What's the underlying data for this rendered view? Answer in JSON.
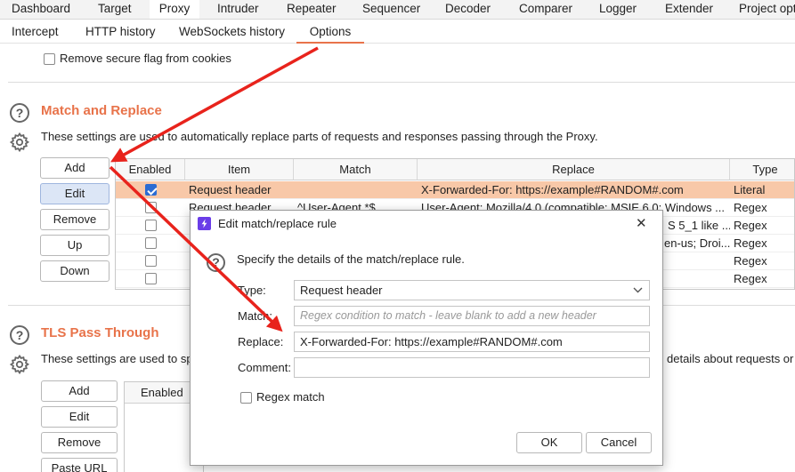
{
  "top_tabs": [
    "Dashboard",
    "Target",
    "Proxy",
    "Intruder",
    "Repeater",
    "Sequencer",
    "Decoder",
    "Comparer",
    "Logger",
    "Extender",
    "Project opt"
  ],
  "sub_tabs": [
    "Intercept",
    "HTTP history",
    "WebSockets history",
    "Options"
  ],
  "remove_secure_flag": {
    "label": "Remove secure flag from cookies",
    "checked": false
  },
  "match_replace": {
    "title": "Match and Replace",
    "description": "These settings are used to automatically replace parts of requests and responses passing through the Proxy.",
    "buttons": {
      "add": "Add",
      "edit": "Edit",
      "remove": "Remove",
      "up": "Up",
      "down": "Down"
    },
    "columns": [
      "Enabled",
      "Item",
      "Match",
      "Replace",
      "Type"
    ],
    "rows": [
      {
        "enabled": true,
        "item": "Request header",
        "match": "",
        "replace": "X-Forwarded-For: https://example#RANDOM#.com",
        "type": "Literal"
      },
      {
        "enabled": false,
        "item": "Request header",
        "match": "^User-Agent.*$",
        "replace": "User-Agent: Mozilla/4.0 (compatible; MSIE 6.0; Windows ...",
        "type": "Regex"
      },
      {
        "enabled": false,
        "item": "",
        "match": "",
        "replace": "S 5_1 like ...",
        "type": "Regex"
      },
      {
        "enabled": false,
        "item": "",
        "match": "",
        "replace": "en-us; Droi...",
        "type": "Regex"
      },
      {
        "enabled": false,
        "item": "",
        "match": "",
        "replace": "",
        "type": "Regex"
      },
      {
        "enabled": false,
        "item": "",
        "match": "",
        "replace": "",
        "type": "Regex"
      }
    ]
  },
  "tls_pass_through": {
    "title": "TLS Pass Through",
    "description_left": "These settings are used to sp",
    "description_right": "details about requests or",
    "buttons": {
      "add": "Add",
      "edit": "Edit",
      "remove": "Remove",
      "paste_url": "Paste URL"
    },
    "columns": [
      "Enabled"
    ]
  },
  "dialog": {
    "title": "Edit match/replace rule",
    "close_glyph": "✕",
    "intro": "Specify the details of the match/replace rule.",
    "type_label": "Type:",
    "type_value": "Request header",
    "match_label": "Match:",
    "match_placeholder": "Regex condition to match - leave blank to add a new header",
    "replace_label": "Replace:",
    "replace_value": "X-Forwarded-For: https://example#RANDOM#.com",
    "comment_label": "Comment:",
    "comment_value": "",
    "regex_label": "Regex match",
    "regex_checked": false,
    "ok": "OK",
    "cancel": "Cancel"
  },
  "colors": {
    "accent": "#e8734a",
    "arrow": "#e8231c",
    "selected_row": "#f8c8a8",
    "checkbox": "#2b6cd3"
  }
}
